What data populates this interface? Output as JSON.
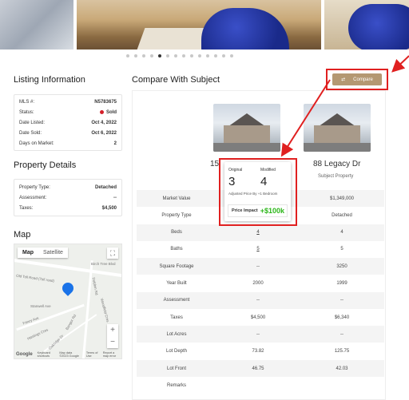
{
  "gallery": {
    "dots": 14,
    "active_dot": 4
  },
  "listing": {
    "title": "Listing Information",
    "rows": [
      {
        "label": "MLS #:",
        "value": "N5783675"
      },
      {
        "label": "Status:",
        "value": "Sold"
      },
      {
        "label": "Date Listed:",
        "value": "Oct 4, 2022"
      },
      {
        "label": "Date Sold:",
        "value": "Oct 6, 2022"
      },
      {
        "label": "Days on Market:",
        "value": "2"
      }
    ]
  },
  "property": {
    "title": "Property Details",
    "rows": [
      {
        "label": "Property Type:",
        "value": "Detached"
      },
      {
        "label": "Assessment:",
        "value": "--"
      },
      {
        "label": "Taxes:",
        "value": "$4,500"
      }
    ]
  },
  "map": {
    "title": "Map",
    "tab_map": "Map",
    "tab_satellite": "Satellite",
    "zoom_in": "+",
    "zoom_out": "−",
    "labels": [
      "Birch Tree Blvd",
      "Old Toll Road (Toll road)",
      "Stanwell Ave",
      "Fancy Ave",
      "Dolphin Rd",
      "Bangor Rd",
      "Hastings Cres",
      "Oakridge Dr",
      "Woodfield Cres"
    ],
    "footer": {
      "google": "Google",
      "keyboard": "Keyboard shortcuts",
      "mapdata": "Map data ©2023 Google",
      "terms": "Terms of Use",
      "report": "Report a map error"
    }
  },
  "compare": {
    "title": "Compare With Subject",
    "button_label": "Compare",
    "button_icon": "compare-arrows-icon",
    "left_address": "15",
    "right_address": "88 Legacy Dr",
    "subject_label": "Subject Property",
    "rows": [
      {
        "label": "Market Value",
        "c1": "",
        "c2": "$1,349,000"
      },
      {
        "label": "Property Type",
        "c1": "",
        "c2": "Detached"
      },
      {
        "label": "Beds",
        "c1": "4",
        "c2": "4"
      },
      {
        "label": "Baths",
        "c1": "5",
        "c2": "5"
      },
      {
        "label": "Square Footage",
        "c1": "--",
        "c2": "3250"
      },
      {
        "label": "Year Built",
        "c1": "2000",
        "c2": "1999"
      },
      {
        "label": "Assessment",
        "c1": "--",
        "c2": "--"
      },
      {
        "label": "Taxes",
        "c1": "$4,500",
        "c2": "$6,340"
      },
      {
        "label": "Lot Acres",
        "c1": "--",
        "c2": "--"
      },
      {
        "label": "Lot Depth",
        "c1": "73.82",
        "c2": "125.75"
      },
      {
        "label": "Lot Front",
        "c1": "46.75",
        "c2": "42.03"
      },
      {
        "label": "Remarks",
        "c1": "",
        "c2": ""
      }
    ]
  },
  "tooltip": {
    "original_label": "Original",
    "original_value": "3",
    "modified_label": "Modified",
    "modified_value": "4",
    "adjusted_text": "Adjusted Price By +1 Bedroom",
    "impact_label": "Price Impact",
    "impact_value": "+$100k",
    "impact_color": "#2cb61a"
  },
  "colors": {
    "accent": "#b49872",
    "highlight": "#e02020",
    "sold": "#d4202a"
  }
}
